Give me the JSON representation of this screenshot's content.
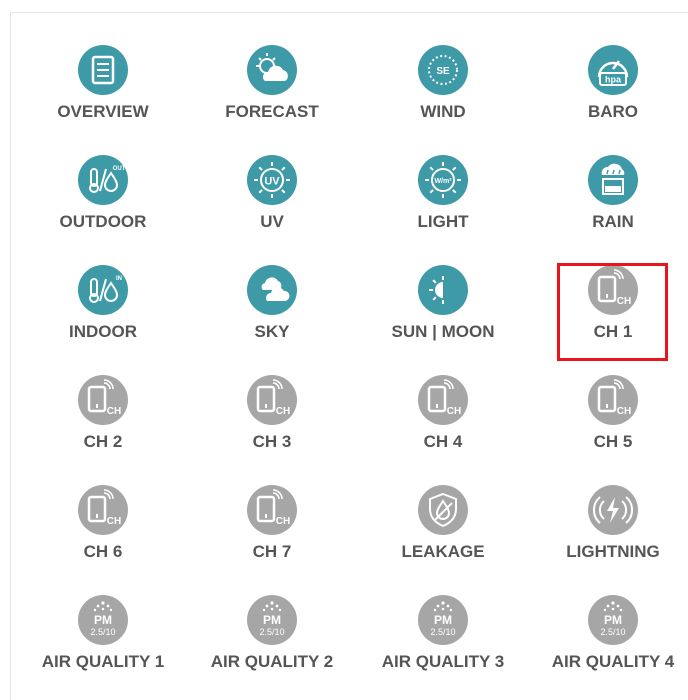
{
  "grid": {
    "tiles": [
      {
        "label": "OVERVIEW",
        "icon": "overview-icon",
        "state": "active"
      },
      {
        "label": "FORECAST",
        "icon": "forecast-icon",
        "state": "active"
      },
      {
        "label": "WIND",
        "icon": "wind-compass-icon",
        "state": "active",
        "icon_text": "SE"
      },
      {
        "label": "BARO",
        "icon": "barometer-icon",
        "state": "active",
        "icon_text": "hpa"
      },
      {
        "label": "OUTDOOR",
        "icon": "outdoor-thermometer-icon",
        "state": "active",
        "icon_text": "OUT"
      },
      {
        "label": "UV",
        "icon": "uv-icon",
        "state": "active",
        "icon_text": "UV"
      },
      {
        "label": "LIGHT",
        "icon": "light-icon",
        "state": "active",
        "icon_text": "W/m²"
      },
      {
        "label": "RAIN",
        "icon": "rain-gauge-icon",
        "state": "active"
      },
      {
        "label": "INDOOR",
        "icon": "indoor-thermometer-icon",
        "state": "active",
        "icon_text": "IN"
      },
      {
        "label": "SKY",
        "icon": "sky-cloud-icon",
        "state": "active"
      },
      {
        "label": "SUN | MOON",
        "icon": "sun-moon-icon",
        "state": "active"
      },
      {
        "label": "CH 1",
        "icon": "channel-sensor-icon",
        "state": "inactive",
        "icon_text": "CH",
        "selected": true
      },
      {
        "label": "CH 2",
        "icon": "channel-sensor-icon",
        "state": "inactive",
        "icon_text": "CH"
      },
      {
        "label": "CH 3",
        "icon": "channel-sensor-icon",
        "state": "inactive",
        "icon_text": "CH"
      },
      {
        "label": "CH 4",
        "icon": "channel-sensor-icon",
        "state": "inactive",
        "icon_text": "CH"
      },
      {
        "label": "CH 5",
        "icon": "channel-sensor-icon",
        "state": "inactive",
        "icon_text": "CH"
      },
      {
        "label": "CH 6",
        "icon": "channel-sensor-icon",
        "state": "inactive",
        "icon_text": "CH"
      },
      {
        "label": "CH 7",
        "icon": "channel-sensor-icon",
        "state": "inactive",
        "icon_text": "CH"
      },
      {
        "label": "LEAKAGE",
        "icon": "leakage-shield-icon",
        "state": "inactive"
      },
      {
        "label": "LIGHTNING",
        "icon": "lightning-icon",
        "state": "inactive"
      },
      {
        "label": "AIR QUALITY 1",
        "icon": "air-quality-pm-icon",
        "state": "inactive",
        "icon_text": "PM",
        "icon_subtext": "2.5/10"
      },
      {
        "label": "AIR QUALITY 2",
        "icon": "air-quality-pm-icon",
        "state": "inactive",
        "icon_text": "PM",
        "icon_subtext": "2.5/10"
      },
      {
        "label": "AIR QUALITY 3",
        "icon": "air-quality-pm-icon",
        "state": "inactive",
        "icon_text": "PM",
        "icon_subtext": "2.5/10"
      },
      {
        "label": "AIR QUALITY 4",
        "icon": "air-quality-pm-icon",
        "state": "inactive",
        "icon_text": "PM",
        "icon_subtext": "2.5/10"
      }
    ]
  },
  "colors": {
    "active": "#3d9aa6",
    "inactive": "#a6a6a6",
    "label": "#555555",
    "selection": "#e8141e"
  }
}
